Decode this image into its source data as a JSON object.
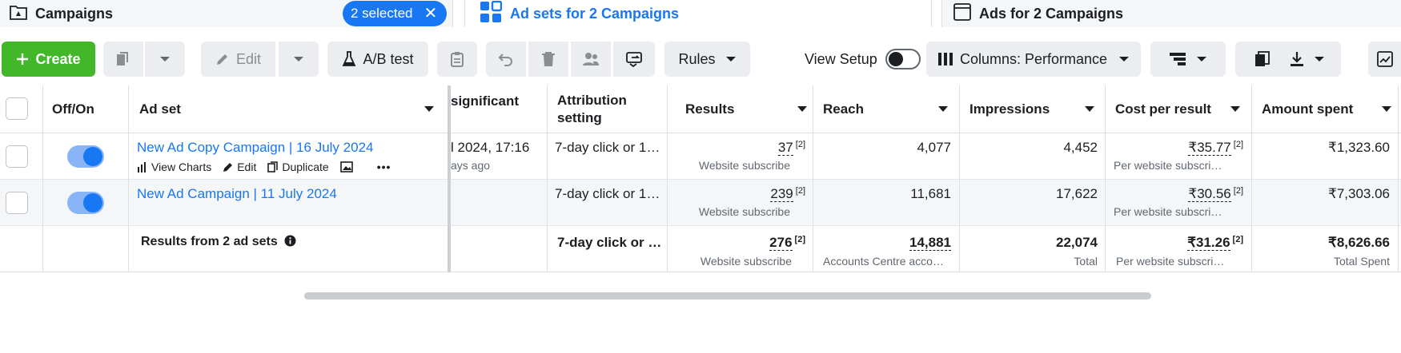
{
  "tabs": {
    "campaigns": {
      "label": "Campaigns",
      "selected_label": "2 selected",
      "clear": "✕"
    },
    "adsets": {
      "label": "Ad sets for 2 Campaigns"
    },
    "ads": {
      "label": "Ads for 2 Campaigns"
    }
  },
  "toolbar": {
    "create": "Create",
    "edit": "Edit",
    "ab_test": "A/B test",
    "rules": "Rules",
    "view_setup": "View Setup",
    "columns": "Columns: Performance"
  },
  "table": {
    "headers": {
      "off_on": "Off/On",
      "ad_set": "Ad set",
      "significant": "significant",
      "attribution": "Attribution setting",
      "results": "Results",
      "reach": "Reach",
      "impressions": "Impressions",
      "cost_per_result": "Cost per result",
      "amount_spent": "Amount spent"
    },
    "row_actions": {
      "view_charts": "View Charts",
      "edit": "Edit",
      "duplicate": "Duplicate",
      "more": "•••"
    },
    "rows": [
      {
        "name": "New Ad Copy Campaign | 16 July 2024",
        "significant": "l 2024, 17:16",
        "significant_sub": "ays ago",
        "attribution": "7-day click or 1…",
        "results": "37",
        "results_sup": "[2]",
        "results_sub": "Website subscribe",
        "reach": "4,077",
        "impressions": "4,452",
        "cost": "₹35.77",
        "cost_sup": "[2]",
        "cost_sub": "Per website subscri…",
        "spent": "₹1,323.60"
      },
      {
        "name": "New Ad Campaign | 11 July 2024",
        "significant": "",
        "significant_sub": "",
        "attribution": "7-day click or 1…",
        "results": "239",
        "results_sup": "[2]",
        "results_sub": "Website subscribe",
        "reach": "11,681",
        "impressions": "17,622",
        "cost": "₹30.56",
        "cost_sup": "[2]",
        "cost_sub": "Per website subscri…",
        "spent": "₹7,303.06"
      }
    ],
    "summary": {
      "label": "Results from 2 ad sets",
      "attribution": "7-day click or …",
      "results": "276",
      "results_sup": "[2]",
      "results_sub": "Website subscribe",
      "reach": "14,881",
      "reach_sub": "Accounts Centre acco…",
      "impressions": "22,074",
      "impressions_sub": "Total",
      "cost": "₹31.26",
      "cost_sup": "[2]",
      "cost_sub": "Per website subscri…",
      "spent": "₹8,626.66",
      "spent_sub": "Total Spent"
    }
  },
  "colors": {
    "accent": "#1877f2",
    "create": "#42b72a",
    "toggle_track": "#8ab4f8"
  },
  "icons": [
    "campaign-folder-icon",
    "adset-grid-icon",
    "ad-window-icon",
    "plus-icon",
    "duplicate-icon",
    "chevron-down-icon",
    "pencil-icon",
    "flask-icon",
    "clipboard-icon",
    "undo-icon",
    "trash-icon",
    "people-icon",
    "swap-icon",
    "columns-icon",
    "breakdown-icon",
    "reports-icon",
    "download-icon",
    "chart-icon",
    "info-icon",
    "bar-chart-icon",
    "image-icon"
  ]
}
